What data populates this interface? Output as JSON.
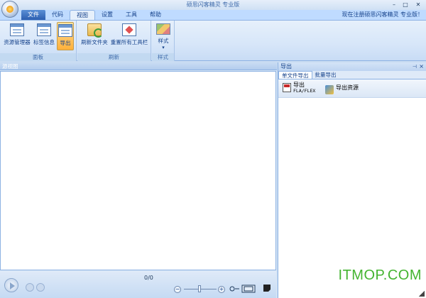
{
  "window": {
    "title": "硕思闪客精灵 专业版",
    "registration_text": "现在注册硕思闪客精灵 专业版！"
  },
  "tabs": [
    "文件",
    "代码",
    "视图",
    "设置",
    "工具",
    "帮助"
  ],
  "active_tab": "视图",
  "ribbon": {
    "groups": [
      {
        "label": "面板",
        "buttons": [
          "资源管理器",
          "标签信息",
          "导出"
        ]
      },
      {
        "label": "刷新",
        "buttons": [
          "刷新文件夹",
          "重置所有工具栏"
        ]
      },
      {
        "label": "样式",
        "buttons": [
          "样式"
        ]
      }
    ]
  },
  "left_pane": {
    "title": "源视图",
    "counter": "0/0"
  },
  "right_pane": {
    "title": "导出",
    "subtabs": [
      "单文件导出",
      "批量导出"
    ],
    "tools": [
      {
        "label": "导出",
        "sublabel": "FLA/FLEX",
        "icon": "fla-file-icon"
      },
      {
        "label": "导出资源",
        "icon": "export-resources-icon"
      }
    ]
  },
  "watermark": "ITMOP.COM",
  "colors": {
    "ribbon_bg": "#dbe8f8",
    "accent": "#15428b",
    "pressed": "#ffc86a",
    "watermark": "#44b430"
  }
}
